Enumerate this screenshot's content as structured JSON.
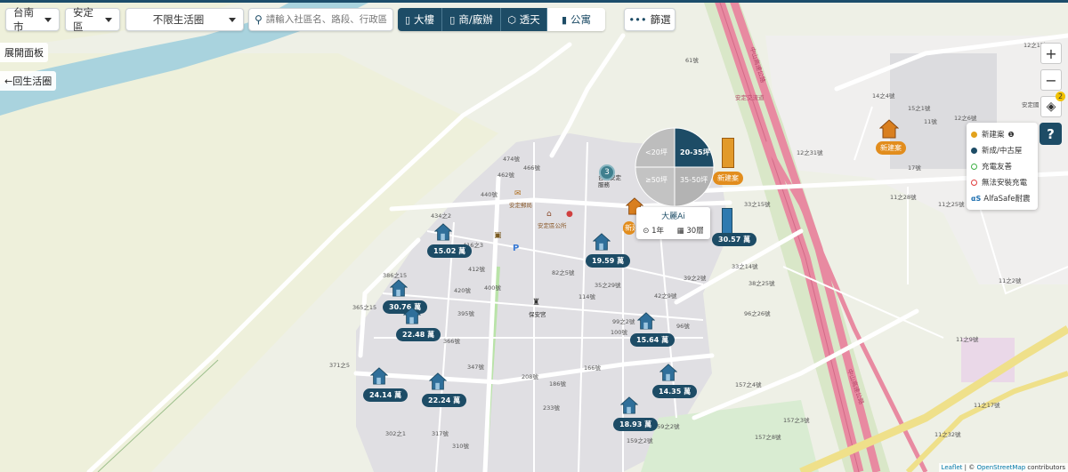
{
  "toolbar": {
    "city": "台南市",
    "district": "安定區",
    "life_circle": "不限生活圈",
    "search_placeholder": "請輸入社區名、路段、行政區",
    "seg_buildings": "大樓",
    "seg_commercial": "商/廠辦",
    "seg_townhouse": "透天",
    "seg_apartment": "公寓",
    "filter": "篩選"
  },
  "left_panel": {
    "expand": "展開面板",
    "back": "←回生活圈"
  },
  "legend": {
    "items": [
      {
        "label": "新建案",
        "color": "#e2a21d"
      },
      {
        "label": "新成/中古屋",
        "color": "#1d4c66"
      },
      {
        "label": "充電友善",
        "color": "#3cb043"
      },
      {
        "label": "無法安裝充電",
        "color": "#e03c3c"
      },
      {
        "label": "AlfaSafe耐震",
        "color": "#1d6fb0"
      }
    ]
  },
  "controls": {
    "zoom_in": "+",
    "zoom_out": "−",
    "layers_badge": "2",
    "help": "?"
  },
  "pie": {
    "s1": "<20坪",
    "s2": "20-35坪",
    "s3": "≥50坪",
    "s4": "35-50坪"
  },
  "popup": {
    "title": "大麗Ai",
    "age": "1年",
    "units": "30層"
  },
  "cluster": "3",
  "listings": [
    {
      "price": "15.02 萬"
    },
    {
      "price": "19.59 萬"
    },
    {
      "price": "30.57 萬"
    },
    {
      "price": "30.76 萬"
    },
    {
      "price": "22.48 萬"
    },
    {
      "price": "15.64 萬"
    },
    {
      "price": "14.35 萬"
    },
    {
      "price": "24.14 萬"
    },
    {
      "price": "22.24 萬"
    },
    {
      "price": "18.93 萬"
    }
  ],
  "new_projects": {
    "a": "新建案",
    "b": "新建案",
    "c": "新建案"
  },
  "places": {
    "post": "安定郵局",
    "office": "安定區公所",
    "station": "保安宮",
    "hospital": "台南安定服務",
    "road1": "中山高速公路",
    "road2": "安定交流道"
  },
  "attribution": {
    "leaflet": "Leaflet",
    "osm": "OpenStreetMap",
    "suffix": "contributors"
  }
}
